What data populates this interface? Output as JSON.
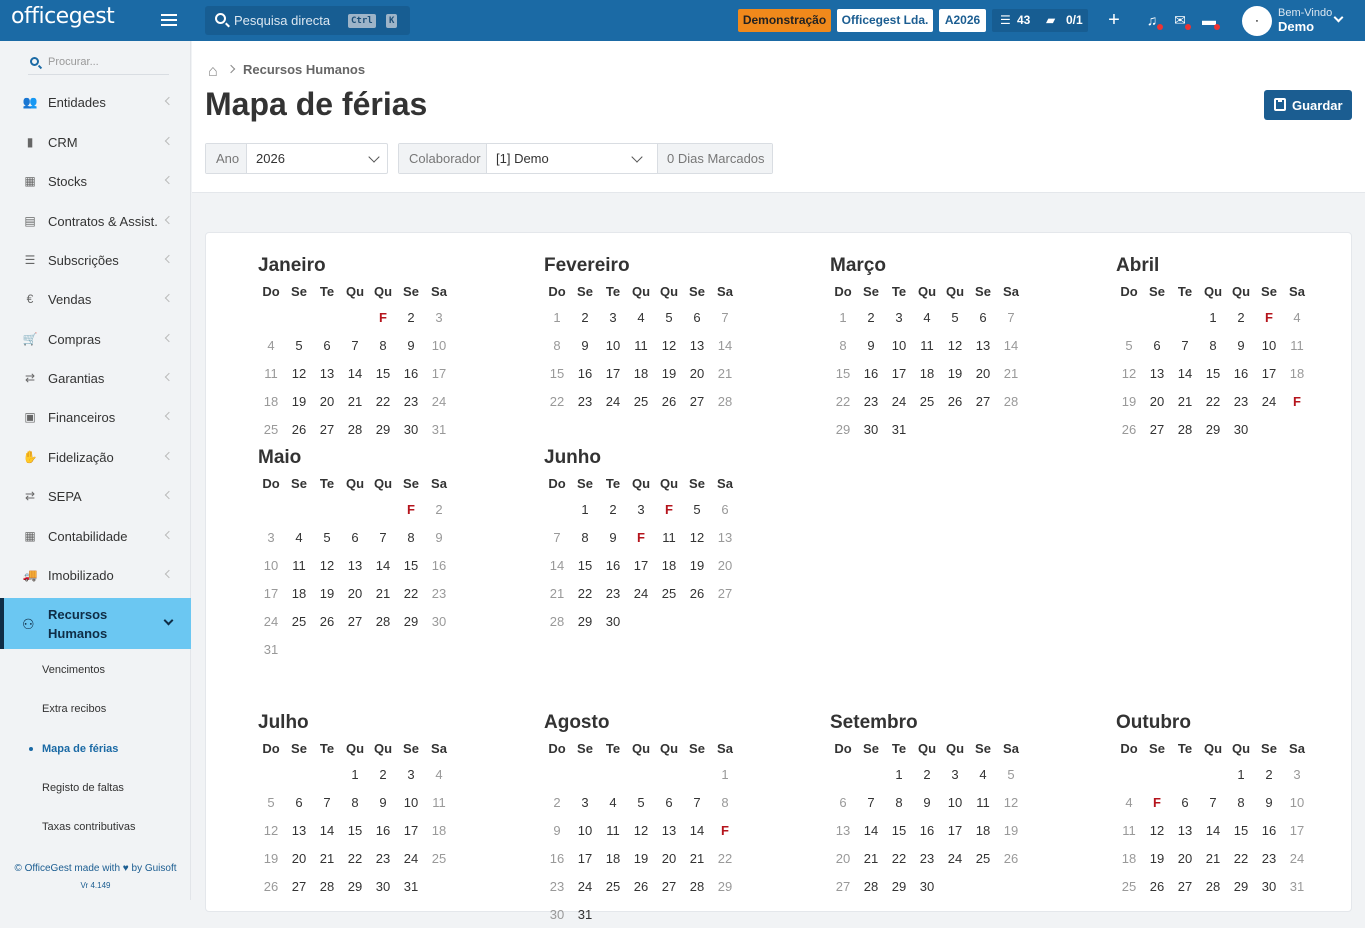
{
  "app": {
    "logo": "officegest"
  },
  "topbar": {
    "search_placeholder": "Pesquisa directa",
    "kbd1": "Ctrl",
    "kbd2": "K",
    "demo_badge": "Demonstração",
    "company": "Officegest Lda.",
    "year_badge": "A2026",
    "tasks_count": "43",
    "docs_count": "0/1",
    "welcome": "Bem-Vindo",
    "user": "Demo",
    "accent_color": "#1b6aa5",
    "demo_color": "#f0891b"
  },
  "sidebar": {
    "search_placeholder": "Procurar...",
    "items": [
      {
        "label": "Entidades",
        "icon": "users-icon"
      },
      {
        "label": "CRM",
        "icon": "book-icon"
      },
      {
        "label": "Stocks",
        "icon": "boxes-icon"
      },
      {
        "label": "Contratos & Assist.",
        "icon": "contract-icon"
      },
      {
        "label": "Subscrições",
        "icon": "list-icon"
      },
      {
        "label": "Vendas",
        "icon": "euro-icon"
      },
      {
        "label": "Compras",
        "icon": "cart-icon"
      },
      {
        "label": "Garantias",
        "icon": "exchange-icon"
      },
      {
        "label": "Financeiros",
        "icon": "money-icon"
      },
      {
        "label": "Fidelização",
        "icon": "hand-coin-icon"
      },
      {
        "label": "SEPA",
        "icon": "exchange-icon"
      },
      {
        "label": "Contabilidade",
        "icon": "calculator-icon"
      },
      {
        "label": "Imobilizado",
        "icon": "truck-icon"
      }
    ],
    "active": {
      "label_line1": "Recursos",
      "label_line2": "Humanos",
      "icon": "sitemap-icon"
    },
    "sub_items": [
      {
        "label": "Vencimentos"
      },
      {
        "label": "Extra recibos"
      },
      {
        "label": "Mapa de férias"
      },
      {
        "label": "Registo de faltas"
      },
      {
        "label": "Taxas contributivas"
      }
    ],
    "footer": "© OfficeGest made with ♥ by Guisoft",
    "version": "Vr 4.149"
  },
  "header": {
    "breadcrumb": "Recursos Humanos",
    "title": "Mapa de férias",
    "save": "Guardar",
    "ano_label": "Ano",
    "ano_value": "2026",
    "colab_label": "Colaborador",
    "colab_value": "[1] Demo",
    "dias_marcados": "0 Dias Marcados"
  },
  "calendar": {
    "weekdays": [
      "Do",
      "Se",
      "Te",
      "Qu",
      "Qu",
      "Se",
      "Sa"
    ],
    "holiday_mark": "F",
    "holiday_color": "#b5141c",
    "months": [
      {
        "name": "Janeiro",
        "first_dow": 4,
        "days": 31,
        "holidays": [
          1
        ]
      },
      {
        "name": "Fevereiro",
        "first_dow": 0,
        "days": 28,
        "holidays": []
      },
      {
        "name": "Março",
        "first_dow": 0,
        "days": 31,
        "holidays": []
      },
      {
        "name": "Abril",
        "first_dow": 3,
        "days": 30,
        "holidays": [
          3,
          25
        ]
      },
      {
        "name": "Maio",
        "first_dow": 5,
        "days": 31,
        "holidays": [
          1
        ]
      },
      {
        "name": "Junho",
        "first_dow": 1,
        "days": 30,
        "holidays": [
          4,
          10
        ]
      },
      {
        "name": "Julho",
        "first_dow": 3,
        "days": 31,
        "holidays": []
      },
      {
        "name": "Agosto",
        "first_dow": 6,
        "days": 31,
        "holidays": [
          15
        ]
      },
      {
        "name": "Setembro",
        "first_dow": 2,
        "days": 30,
        "holidays": []
      },
      {
        "name": "Outubro",
        "first_dow": 4,
        "days": 31,
        "holidays": [
          5
        ]
      }
    ]
  }
}
